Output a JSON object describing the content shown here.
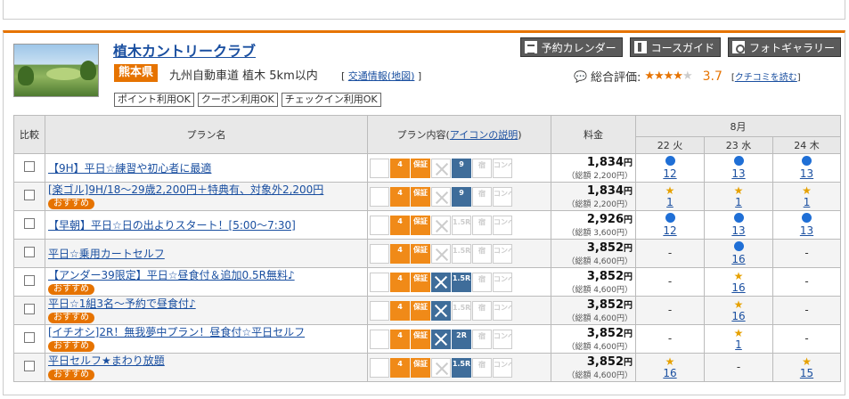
{
  "club": {
    "name": "植木カントリークラブ",
    "prefecture": "熊本県",
    "access": "九州自動車道 植木 5km以内",
    "access_link": "交通情報(地図)",
    "tags": [
      "ポイント利用OK",
      "クーポン利用OK",
      "チェックイン利用OK"
    ]
  },
  "nav": {
    "calendar": "予約カレンダー",
    "course": "コースガイド",
    "gallery": "フォトギャラリー"
  },
  "rating": {
    "label": "総合評価:",
    "stars_on": "★★★★",
    "stars_off": "★",
    "score": "3.7",
    "review_link": "クチコミを読む"
  },
  "table": {
    "col_compare": "比較",
    "col_plan": "プラン名",
    "col_content_prefix": "プラン内容(",
    "col_content_link": "アイコンの説明",
    "col_content_suffix": ")",
    "col_price": "料金",
    "month": "8月",
    "days": [
      "22 火",
      "23 水",
      "24 木"
    ],
    "badge": "おすすめ",
    "total_prefix": "（総額 ",
    "total_suffix": "）",
    "yen": "円"
  },
  "plans": [
    {
      "name": "【9H】平日☆練習や初心者に最適",
      "rec": false,
      "price": "1,834",
      "total": "2,200円",
      "icons": [
        [
          "g",
          ""
        ],
        [
          "o",
          "4"
        ],
        [
          "o",
          "保証"
        ],
        [
          "g x",
          ""
        ],
        [
          "b",
          "9"
        ],
        [
          "g",
          "宿"
        ],
        [
          "g",
          "コンペ特典"
        ]
      ],
      "days": [
        {
          "m": "dot",
          "n": "12"
        },
        {
          "m": "dot",
          "n": "13"
        },
        {
          "m": "dot",
          "n": "13"
        }
      ]
    },
    {
      "name": "[楽ゴル]9H/18〜29歳2,200円＋特典有、対象外2,200円",
      "rec": true,
      "price": "1,834",
      "total": "2,200円",
      "icons": [
        [
          "g",
          ""
        ],
        [
          "o",
          "4"
        ],
        [
          "o",
          "保証"
        ],
        [
          "g x",
          ""
        ],
        [
          "b",
          "9"
        ],
        [
          "g",
          "宿"
        ],
        [
          "g",
          "コンペ特典"
        ]
      ],
      "days": [
        {
          "m": "star",
          "n": "1"
        },
        {
          "m": "star",
          "n": "1"
        },
        {
          "m": "star",
          "n": "1"
        }
      ]
    },
    {
      "name": "【早朝】平日☆日の出よりスタート！[5:00〜7:30]",
      "rec": false,
      "price": "2,926",
      "total": "3,600円",
      "icons": [
        [
          "g",
          ""
        ],
        [
          "o",
          "4"
        ],
        [
          "o",
          "保証"
        ],
        [
          "g x",
          ""
        ],
        [
          "g",
          "1.5R"
        ],
        [
          "g",
          "宿"
        ],
        [
          "g",
          "コンペ特典"
        ]
      ],
      "days": [
        {
          "m": "dot",
          "n": "12"
        },
        {
          "m": "dot",
          "n": "13"
        },
        {
          "m": "dot",
          "n": "13"
        }
      ]
    },
    {
      "name": "平日☆乗用カートセルフ",
      "rec": false,
      "price": "3,852",
      "total": "4,600円",
      "icons": [
        [
          "g",
          ""
        ],
        [
          "o",
          "4"
        ],
        [
          "o",
          "保証"
        ],
        [
          "g x",
          ""
        ],
        [
          "g",
          "1.5R"
        ],
        [
          "g",
          "宿"
        ],
        [
          "g",
          "コンペ特典"
        ]
      ],
      "days": [
        {
          "m": "dash",
          "n": "-"
        },
        {
          "m": "dot",
          "n": "16"
        },
        {
          "m": "dash",
          "n": "-"
        }
      ]
    },
    {
      "name": "【アンダー39限定】平日☆昼食付＆追加0.5R無料♪",
      "rec": true,
      "price": "3,852",
      "total": "4,600円",
      "icons": [
        [
          "g",
          ""
        ],
        [
          "o",
          "4"
        ],
        [
          "o",
          "保証"
        ],
        [
          "b x",
          ""
        ],
        [
          "b",
          "1.5R"
        ],
        [
          "g",
          "宿"
        ],
        [
          "g",
          "コンペ特典"
        ]
      ],
      "days": [
        {
          "m": "dash",
          "n": "-"
        },
        {
          "m": "star",
          "n": "16"
        },
        {
          "m": "dash",
          "n": "-"
        }
      ]
    },
    {
      "name": "平日☆1組3名〜予約で昼食付♪",
      "rec": true,
      "price": "3,852",
      "total": "4,600円",
      "icons": [
        [
          "g",
          ""
        ],
        [
          "o",
          "4"
        ],
        [
          "o",
          "保証"
        ],
        [
          "b x",
          ""
        ],
        [
          "g",
          "1.5R"
        ],
        [
          "g",
          "宿"
        ],
        [
          "g",
          "コンペ特典"
        ]
      ],
      "days": [
        {
          "m": "dash",
          "n": "-"
        },
        {
          "m": "star",
          "n": "16"
        },
        {
          "m": "dash",
          "n": "-"
        }
      ]
    },
    {
      "name": "[イチオシ]2R！無我夢中プラン！昼食付☆平日セルフ",
      "rec": true,
      "price": "3,852",
      "total": "4,600円",
      "icons": [
        [
          "g",
          ""
        ],
        [
          "o",
          "4"
        ],
        [
          "o",
          "保証"
        ],
        [
          "b x",
          ""
        ],
        [
          "b",
          "2R"
        ],
        [
          "g",
          "宿"
        ],
        [
          "g",
          "コンペ特典"
        ]
      ],
      "days": [
        {
          "m": "dash",
          "n": "-"
        },
        {
          "m": "star",
          "n": "1"
        },
        {
          "m": "dash",
          "n": "-"
        }
      ]
    },
    {
      "name": "平日セルフ★まわり放題",
      "rec": true,
      "price": "3,852",
      "total": "4,600円",
      "icons": [
        [
          "g",
          ""
        ],
        [
          "o",
          "4"
        ],
        [
          "o",
          "保証"
        ],
        [
          "g x",
          ""
        ],
        [
          "b",
          "1.5R"
        ],
        [
          "g",
          "宿"
        ],
        [
          "g",
          "コンペ特典"
        ]
      ],
      "days": [
        {
          "m": "star",
          "n": "16"
        },
        {
          "m": "dash",
          "n": "-"
        },
        {
          "m": "star",
          "n": "15"
        }
      ]
    }
  ]
}
